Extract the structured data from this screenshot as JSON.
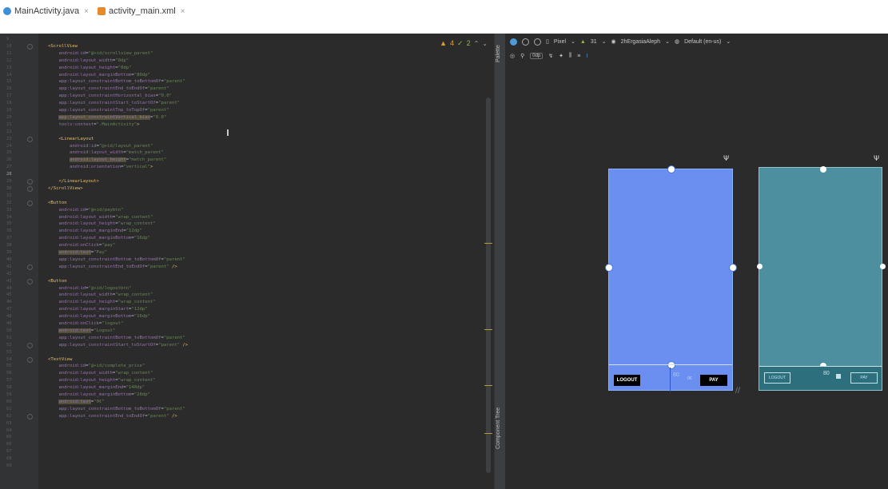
{
  "tabs": [
    {
      "label": "MainActivity.java",
      "icon": "java-class-icon"
    },
    {
      "label": "activity_main.xml",
      "icon": "layout-file-icon"
    }
  ],
  "inspection": {
    "warnings": "4",
    "weak": "2"
  },
  "gutter": {
    "line_numbers": [
      "9",
      "10",
      "11",
      "12",
      "13",
      "14",
      "15",
      "16",
      "17",
      "18",
      "19",
      "20",
      "21",
      "22",
      "23",
      "24",
      "25",
      "26",
      "27",
      "28",
      "29",
      "30",
      "31",
      "32",
      "33",
      "34",
      "35",
      "36",
      "37",
      "38",
      "39",
      "40",
      "41",
      "42",
      "43",
      "44",
      "45",
      "46",
      "47",
      "48",
      "49",
      "50",
      "51",
      "52",
      "53",
      "54",
      "55",
      "56",
      "57",
      "58",
      "59",
      "60",
      "61",
      "62",
      "63",
      "64",
      "65",
      "66",
      "67",
      "68",
      "69"
    ]
  },
  "code_lines": [
    {
      "text": ""
    },
    {
      "text": "<ScrollView",
      "kind": "tag"
    },
    {
      "text": "    android:id=\"@+id/scrollview_parent\"",
      "kind": "attr"
    },
    {
      "text": "    android:layout_width=\"0dp\"",
      "kind": "attr"
    },
    {
      "text": "    android:layout_height=\"0dp\"",
      "kind": "attr"
    },
    {
      "text": "    android:layout_marginBottom=\"80dp\"",
      "kind": "attr"
    },
    {
      "text": "    app:layout_constraintBottom_toBottomOf=\"parent\"",
      "kind": "attr"
    },
    {
      "text": "    app:layout_constraintEnd_toEndOf=\"parent\"",
      "kind": "attr"
    },
    {
      "text": "    app:layout_constraintHorizontal_bias=\"0.0\"",
      "kind": "attr"
    },
    {
      "text": "    app:layout_constraintStart_toStartOf=\"parent\"",
      "kind": "attr"
    },
    {
      "text": "    app:layout_constraintTop_toTopOf=\"parent\"",
      "kind": "attr"
    },
    {
      "text": "    app:layout_constraintVertical_bias=\"0.0\"",
      "kind": "attr",
      "hl": true
    },
    {
      "text": "    tools:context=\".MainActivity\">",
      "kind": "attr"
    },
    {
      "text": ""
    },
    {
      "text": "    <LinearLayout",
      "kind": "tag"
    },
    {
      "text": "        android:id=\"@+id/layout_parent\"",
      "kind": "attr"
    },
    {
      "text": "        android:layout_width=\"match_parent\"",
      "kind": "attr"
    },
    {
      "text": "        android:layout_height=\"match_parent\"",
      "kind": "attr",
      "hl": true
    },
    {
      "text": "        android:orientation=\"vertical\">",
      "kind": "attr"
    },
    {
      "text": ""
    },
    {
      "text": "    </LinearLayout>",
      "kind": "tag"
    },
    {
      "text": "</ScrollView>",
      "kind": "tag"
    },
    {
      "text": ""
    },
    {
      "text": "<Button",
      "kind": "tag"
    },
    {
      "text": "    android:id=\"@+id/paybtn\"",
      "kind": "attr"
    },
    {
      "text": "    android:layout_width=\"wrap_content\"",
      "kind": "attr"
    },
    {
      "text": "    android:layout_height=\"wrap_content\"",
      "kind": "attr"
    },
    {
      "text": "    android:layout_marginEnd=\"12dp\"",
      "kind": "attr"
    },
    {
      "text": "    android:layout_marginBottom=\"16dp\"",
      "kind": "attr"
    },
    {
      "text": "    android:onClick=\"pay\"",
      "kind": "attr"
    },
    {
      "text": "    android:text=\"Pay\"",
      "kind": "attr",
      "hl": true
    },
    {
      "text": "    app:layout_constraintBottom_toBottomOf=\"parent\"",
      "kind": "attr"
    },
    {
      "text": "    app:layout_constraintEnd_toEndOf=\"parent\" />",
      "kind": "attr"
    },
    {
      "text": ""
    },
    {
      "text": "<Button",
      "kind": "tag"
    },
    {
      "text": "    android:id=\"@+id/logoutbtn\"",
      "kind": "attr"
    },
    {
      "text": "    android:layout_width=\"wrap_content\"",
      "kind": "attr"
    },
    {
      "text": "    android:layout_height=\"wrap_content\"",
      "kind": "attr"
    },
    {
      "text": "    android:layout_marginStart=\"12dp\"",
      "kind": "attr"
    },
    {
      "text": "    android:layout_marginBottom=\"16dp\"",
      "kind": "attr"
    },
    {
      "text": "    android:onClick=\"logout\"",
      "kind": "attr"
    },
    {
      "text": "    android:text=\"Logout\"",
      "kind": "attr",
      "hl": true
    },
    {
      "text": "    app:layout_constraintBottom_toBottomOf=\"parent\"",
      "kind": "attr"
    },
    {
      "text": "    app:layout_constraintStart_toStartOf=\"parent\" />",
      "kind": "attr"
    },
    {
      "text": ""
    },
    {
      "text": "<TextView",
      "kind": "tag"
    },
    {
      "text": "    android:id=\"@+id/complete_price\"",
      "kind": "attr"
    },
    {
      "text": "    android:layout_width=\"wrap_content\"",
      "kind": "attr"
    },
    {
      "text": "    android:layout_height=\"wrap_content\"",
      "kind": "attr"
    },
    {
      "text": "    android:layout_marginEnd=\"140dp\"",
      "kind": "attr"
    },
    {
      "text": "    android:layout_marginBottom=\"28dp\"",
      "kind": "attr"
    },
    {
      "text": "    android:text=\"0€\"",
      "kind": "attr",
      "hl": true
    },
    {
      "text": "    app:layout_constraintBottom_toBottomOf=\"parent\"",
      "kind": "attr"
    },
    {
      "text": "    app:layout_constraintEnd_toEndOf=\"parent\" />",
      "kind": "attr"
    }
  ],
  "side_panels": {
    "palette": "Palette",
    "component_tree": "Component Tree"
  },
  "design_toolbar": {
    "device": "Pixel",
    "api": "31",
    "theme": "2hErgasiaAleph",
    "locale": "Default (en-us)",
    "margin": "0dp"
  },
  "design_preview": {
    "logout_label": "LOGOUT",
    "pay_label": "PAY",
    "margin_value": "80",
    "price_text": "0€"
  },
  "blueprint_preview": {
    "logout_label": "LOGOUT",
    "pay_label": "PAY",
    "margin_value": "80"
  }
}
